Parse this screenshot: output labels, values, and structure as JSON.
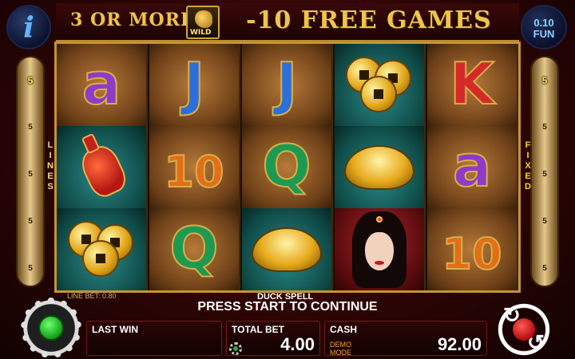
{
  "banner": {
    "left_text": "3 OR MORE",
    "wild_label": "WILD",
    "right_text": "-10 FREE GAMES"
  },
  "info_button": {
    "symbol": "i"
  },
  "fun_button": {
    "amount": "0.10",
    "label": "FUN"
  },
  "paylines": {
    "left": [
      "5",
      "5",
      "5",
      "5",
      "5"
    ],
    "right": [
      "5",
      "5",
      "5",
      "5",
      "5"
    ],
    "left_vertical": "LINES",
    "right_vertical": "FIXED"
  },
  "reels": [
    [
      {
        "type": "letter",
        "value": "a",
        "color": "#8e3cc8"
      },
      {
        "type": "vase",
        "value": "vase"
      },
      {
        "type": "coins",
        "value": "coins"
      }
    ],
    [
      {
        "type": "letter",
        "value": "J",
        "color": "#2d6fd8"
      },
      {
        "type": "letter",
        "value": "10",
        "color": "#e26e18"
      },
      {
        "type": "letter",
        "value": "Q",
        "color": "#1d9a52"
      }
    ],
    [
      {
        "type": "letter",
        "value": "J",
        "color": "#2d6fd8"
      },
      {
        "type": "letter",
        "value": "Q",
        "color": "#1d9a52"
      },
      {
        "type": "ingot",
        "value": "ingot"
      }
    ],
    [
      {
        "type": "coins",
        "value": "coins"
      },
      {
        "type": "ingot",
        "value": "ingot"
      },
      {
        "type": "lady",
        "value": "lady"
      }
    ],
    [
      {
        "type": "letter",
        "value": "K",
        "color": "#d62a2a"
      },
      {
        "type": "letter",
        "value": "a",
        "color": "#8e3cc8"
      },
      {
        "type": "letter",
        "value": "10",
        "color": "#e26e18"
      }
    ]
  ],
  "footer": {
    "line_bet": "LINE BET: 0.80",
    "game_name": "DUCK SPELL",
    "message": "PRESS START TO CONTINUE"
  },
  "panels": {
    "last_win_label": "LAST WIN",
    "total_bet_label": "TOTAL BET",
    "total_bet_value": "4.00",
    "cash_label": "CASH",
    "cash_value": "92.00",
    "demo_mode": "DEMO MODE"
  },
  "icons": {
    "settings": "gear-icon",
    "spin": "spin-arrows-icon"
  }
}
